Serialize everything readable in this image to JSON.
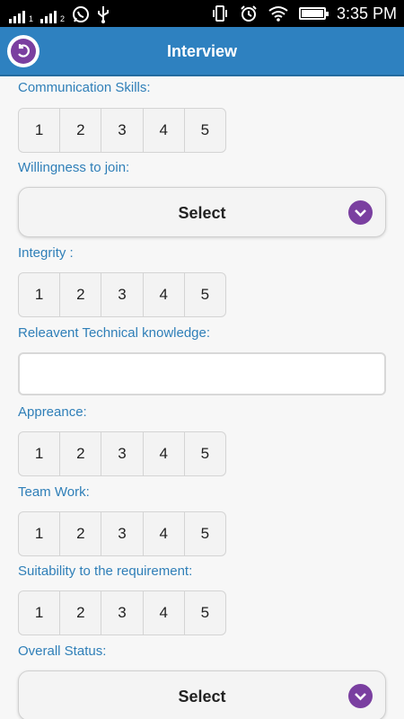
{
  "status_bar": {
    "sim1_label": "1",
    "sim2_label": "2",
    "time": "3:35 PM"
  },
  "header": {
    "title": "Interview"
  },
  "form": {
    "communication": {
      "label": "Communication Skills:",
      "options": [
        "1",
        "2",
        "3",
        "4",
        "5"
      ]
    },
    "willingness": {
      "label": "Willingness to join:",
      "value": "Select"
    },
    "integrity": {
      "label": "Integrity :",
      "options": [
        "1",
        "2",
        "3",
        "4",
        "5"
      ]
    },
    "technical": {
      "label": "Releavent Technical knowledge:",
      "value": ""
    },
    "appearance": {
      "label": "Appreance:",
      "options": [
        "1",
        "2",
        "3",
        "4",
        "5"
      ]
    },
    "teamwork": {
      "label": "Team Work:",
      "options": [
        "1",
        "2",
        "3",
        "4",
        "5"
      ]
    },
    "suitability": {
      "label": "Suitability to the requirement:",
      "options": [
        "1",
        "2",
        "3",
        "4",
        "5"
      ]
    },
    "overall": {
      "label": "Overall Status:",
      "value": "Select"
    }
  },
  "colors": {
    "appbar": "#2e81c0",
    "label": "#2f7fb8",
    "accent": "#7a3fa0"
  },
  "icons": [
    "signal-icon",
    "whatsapp-icon",
    "usb-icon",
    "vibrate-icon",
    "alarm-icon",
    "wifi-icon",
    "battery-icon",
    "back-icon",
    "chevron-down-icon"
  ]
}
